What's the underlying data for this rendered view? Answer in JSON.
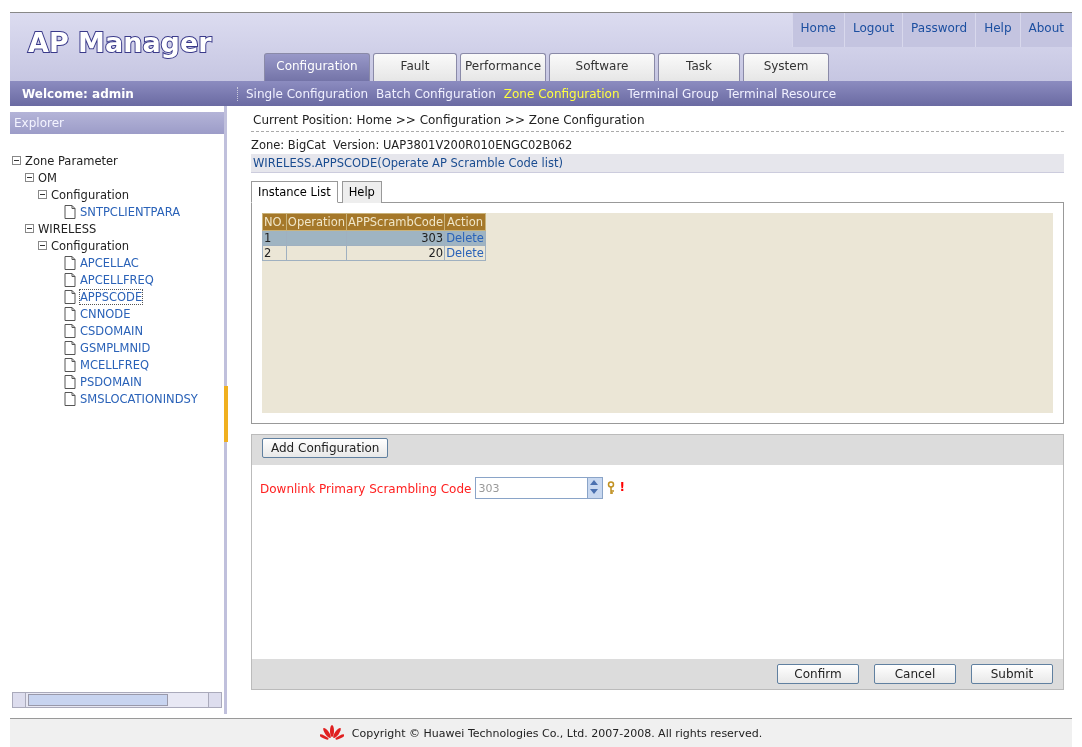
{
  "header": {
    "logo": "AP Manager",
    "links": [
      "Home",
      "Logout",
      "Password",
      "Help",
      "About"
    ],
    "tabs": [
      {
        "label": "Configuration",
        "selected": true
      },
      {
        "label": "Fault",
        "selected": false
      },
      {
        "label": "Performance",
        "selected": false
      },
      {
        "label": "Software",
        "selected": false
      },
      {
        "label": "Task",
        "selected": false
      },
      {
        "label": "System",
        "selected": false
      }
    ]
  },
  "nav": {
    "welcome": "Welcome: admin",
    "items": [
      {
        "label": "Single Configuration",
        "selected": false
      },
      {
        "label": "Batch Configuration",
        "selected": false
      },
      {
        "label": "Zone Configuration",
        "selected": true
      },
      {
        "label": "Terminal Group",
        "selected": false
      },
      {
        "label": "Terminal Resource",
        "selected": false
      }
    ]
  },
  "sidebar": {
    "title": "Explorer",
    "tree": [
      {
        "label": "Zone Parameter",
        "kind": "folder",
        "expanded": true,
        "children": [
          {
            "label": "OM",
            "kind": "folder",
            "expanded": true,
            "children": [
              {
                "label": "Configuration",
                "kind": "folder",
                "expanded": true,
                "children": [
                  {
                    "label": "SNTPCLIENTPARA",
                    "kind": "leaf",
                    "selected": false
                  }
                ]
              }
            ]
          },
          {
            "label": "WIRELESS",
            "kind": "folder",
            "expanded": true,
            "children": [
              {
                "label": "Configuration",
                "kind": "folder",
                "expanded": true,
                "children": [
                  {
                    "label": "APCELLAC",
                    "kind": "leaf",
                    "selected": false
                  },
                  {
                    "label": "APCELLFREQ",
                    "kind": "leaf",
                    "selected": false
                  },
                  {
                    "label": "APPSCODE",
                    "kind": "leaf",
                    "selected": true
                  },
                  {
                    "label": "CNNODE",
                    "kind": "leaf",
                    "selected": false
                  },
                  {
                    "label": "CSDOMAIN",
                    "kind": "leaf",
                    "selected": false
                  },
                  {
                    "label": "GSMPLMNID",
                    "kind": "leaf",
                    "selected": false
                  },
                  {
                    "label": "MCELLFREQ",
                    "kind": "leaf",
                    "selected": false
                  },
                  {
                    "label": "PSDOMAIN",
                    "kind": "leaf",
                    "selected": false
                  },
                  {
                    "label": "SMSLOCATIONINDSY",
                    "kind": "leaf",
                    "selected": false
                  }
                ]
              }
            ]
          }
        ]
      }
    ]
  },
  "content": {
    "breadcrumb": "Current Position: Home >> Configuration >> Zone Configuration",
    "zone_info": "Zone: BigCat  Version: UAP3801V200R010ENGC02B062",
    "section_title": "WIRELESS.APPSCODE(Operate AP Scramble Code list)",
    "tabs": [
      {
        "label": "Instance List",
        "selected": true
      },
      {
        "label": "Help",
        "selected": false
      }
    ],
    "table": {
      "columns": [
        "NO.",
        "Operation",
        "APPScrambCode",
        "Action"
      ],
      "rows": [
        {
          "cells": [
            "1",
            "",
            "303",
            "Delete"
          ],
          "selected": true
        },
        {
          "cells": [
            "2",
            "",
            "20",
            "Delete"
          ],
          "selected": false
        }
      ]
    },
    "add_button": "Add Configuration",
    "form": {
      "label": "Downlink Primary Scrambling Code",
      "value": "303",
      "required_mark": "!"
    },
    "buttons": [
      "Confirm",
      "Cancel",
      "Submit"
    ]
  },
  "footer": "Copyright © Huawei Technologies Co., Ltd. 2007-2008. All rights reserved."
}
